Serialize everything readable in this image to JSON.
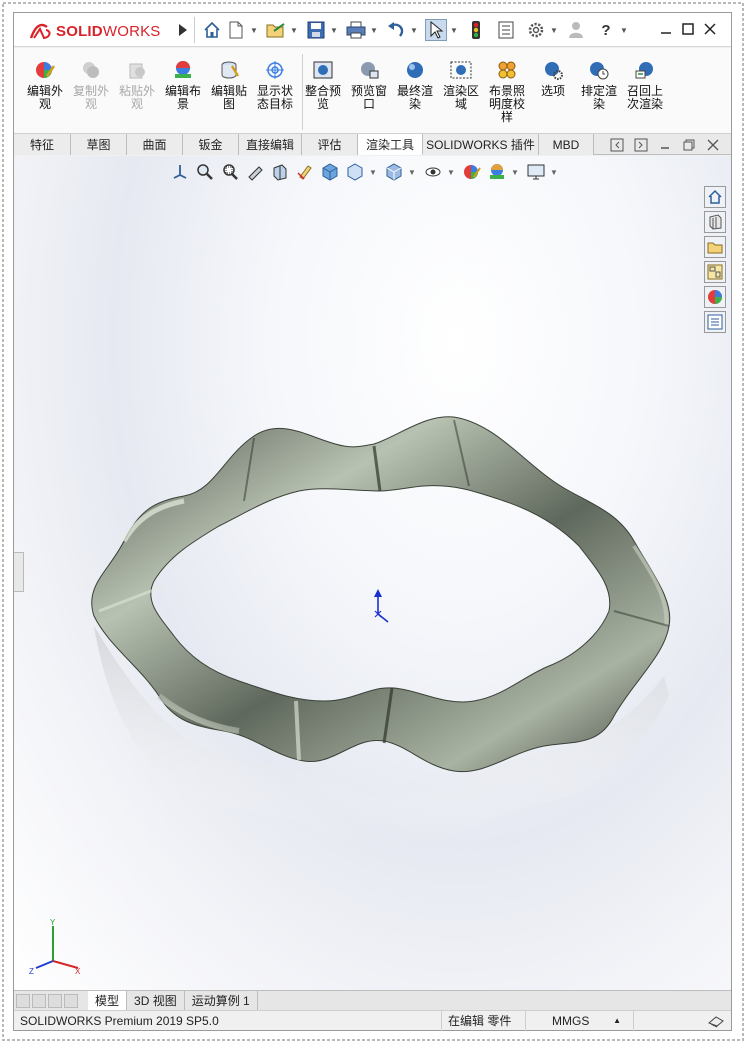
{
  "app": {
    "brand_prefix": "SOLID",
    "brand_suffix": "WORKS"
  },
  "titlebar": {
    "expand_icon": "play-arrow-icon",
    "quick_access": [
      {
        "name": "home-icon"
      },
      {
        "name": "new-document-icon"
      },
      {
        "name": "open-folder-icon"
      },
      {
        "name": "save-icon"
      },
      {
        "name": "print-icon"
      },
      {
        "name": "undo-icon"
      },
      {
        "name": "select-arrow-icon"
      },
      {
        "name": "rebuild-traffic-light-icon"
      },
      {
        "name": "file-properties-icon"
      },
      {
        "name": "options-gear-icon"
      },
      {
        "name": "user-icon"
      },
      {
        "name": "help-icon"
      }
    ],
    "help_label": "?"
  },
  "commands": [
    {
      "label": "编辑外观",
      "enabled": true,
      "icon": "edit-appearance-icon"
    },
    {
      "label": "复制外观",
      "enabled": false,
      "icon": "copy-appearance-icon"
    },
    {
      "label": "粘贴外观",
      "enabled": false,
      "icon": "paste-appearance-icon"
    },
    {
      "label": "编辑布景",
      "enabled": true,
      "icon": "edit-scene-icon"
    },
    {
      "label": "编辑贴图",
      "enabled": true,
      "icon": "edit-decal-icon"
    },
    {
      "label": "显示状态目标",
      "enabled": true,
      "icon": "display-state-target-icon"
    },
    {
      "label": "整合预览",
      "enabled": true,
      "icon": "integrated-preview-icon"
    },
    {
      "label": "预览窗口",
      "enabled": true,
      "icon": "preview-window-icon"
    },
    {
      "label": "最终渲染",
      "enabled": true,
      "icon": "final-render-icon"
    },
    {
      "label": "渲染区域",
      "enabled": true,
      "icon": "render-region-icon"
    },
    {
      "label": "布景照明度校样",
      "enabled": true,
      "icon": "scene-illumination-proof-icon"
    },
    {
      "label": "选项",
      "enabled": true,
      "icon": "options-icon"
    },
    {
      "label": "排定渲染",
      "enabled": true,
      "icon": "schedule-render-icon"
    },
    {
      "label": "召回上次渲染",
      "enabled": true,
      "icon": "recall-last-render-icon"
    }
  ],
  "tabs": [
    {
      "label": "特征",
      "active": false
    },
    {
      "label": "草图",
      "active": false
    },
    {
      "label": "曲面",
      "active": false
    },
    {
      "label": "钣金",
      "active": false
    },
    {
      "label": "直接编辑",
      "active": false
    },
    {
      "label": "评估",
      "active": false
    },
    {
      "label": "渲染工具",
      "active": true
    },
    {
      "label": "SOLIDWORKS 插件",
      "active": false
    },
    {
      "label": "MBD",
      "active": false
    }
  ],
  "heads_up_toolbar": [
    "view-orientation-icon",
    "zoom-to-fit-icon",
    "zoom-to-area-icon",
    "previous-view-icon",
    "section-view-icon",
    "dynamic-annotation-icon",
    "view-cube-icon",
    "display-style-icon",
    "hide-show-items-icon",
    "edit-appearance-icon",
    "apply-scene-icon",
    "view-settings-icon"
  ],
  "task_pane": [
    "solidworks-resources-icon",
    "design-library-icon",
    "file-explorer-icon",
    "view-palette-icon",
    "appearances-scenes-icon",
    "custom-properties-icon"
  ],
  "bottom_tabs": [
    {
      "label": "模型",
      "active": true
    },
    {
      "label": "3D 视图",
      "active": false
    },
    {
      "label": "运动算例 1",
      "active": false
    }
  ],
  "status": {
    "version": "SOLIDWORKS Premium 2019 SP5.0",
    "mode": "在编辑 零件",
    "units": "MMGS",
    "units_arrow": "▲"
  },
  "triad": {
    "x": "X",
    "y": "Y",
    "z": "Z"
  },
  "colors": {
    "brand_red": "#d8232a",
    "part_metal": "#8f978a",
    "active_tab": "#ffffff"
  }
}
